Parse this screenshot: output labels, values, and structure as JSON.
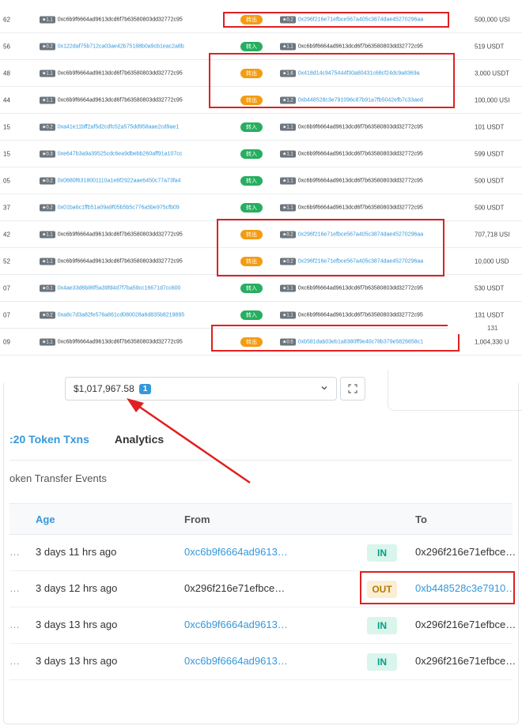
{
  "top_table": {
    "rows": [
      {
        "block": "62",
        "from_score": "★1.1",
        "from": "0xc6b9f6664ad9613dcd6f7b63580803dd32772c95",
        "from_link": false,
        "dir": "转出",
        "dir_type": "out",
        "to_score": "★0.2",
        "to": "0x296f216e71efbce567a405c3874dae45270296aa",
        "to_link": true,
        "amount": "500,000 USI"
      },
      {
        "block": "56",
        "from_score": "★0.2",
        "from": "0x122daf75b712ca03ae42b75188b0a9cb1eac2a8b",
        "from_link": true,
        "dir": "转入",
        "dir_type": "in",
        "to_score": "★1.1",
        "to": "0xc6b9f6664ad9613dcd6f7b63580803dd32772c95",
        "to_link": false,
        "amount": "519 USDT"
      },
      {
        "block": "48",
        "from_score": "★1.1",
        "from": "0xc6b9f6664ad9613dcd6f7b63580803dd32772c95",
        "from_link": false,
        "dir": "转出",
        "dir_type": "out",
        "to_score": "★1.6",
        "to": "0x418d14c9475444f30a80431c68cf24dc9a8369a",
        "to_link": true,
        "amount": "3,000 USDT"
      },
      {
        "block": "44",
        "from_score": "★1.1",
        "from": "0xc6b9f6664ad9613dcd6f7b63580803dd32772c95",
        "from_link": false,
        "dir": "转出",
        "dir_type": "out",
        "to_score": "★1.2",
        "to": "0xb448528c3e791096c87b91a7fb5042efb7c33aed",
        "to_link": true,
        "amount": "100,000 USI"
      },
      {
        "block": "15",
        "from_score": "★0.2",
        "from": "0xa41e11bff2af5d2cdfc52a575dd958aae2cd9ae1",
        "from_link": true,
        "dir": "转入",
        "dir_type": "in",
        "to_score": "★1.1",
        "to": "0xc6b9f6664ad9613dcd6f7b63580803dd32772c95",
        "to_link": false,
        "amount": "101 USDT"
      },
      {
        "block": "15",
        "from_score": "★0.3",
        "from": "0xe647b3a9a39525cdc6ea9dbebb260aff91a107cc",
        "from_link": true,
        "dir": "转入",
        "dir_type": "in",
        "to_score": "★1.1",
        "to": "0xc6b9f6664ad9613dcd6f7b63580803dd32772c95",
        "to_link": false,
        "amount": "599 USDT"
      },
      {
        "block": "05",
        "from_score": "★0.2",
        "from": "0x0680f6318001110a1e6f2922aae6450c77a73fa4",
        "from_link": true,
        "dir": "转入",
        "dir_type": "in",
        "to_score": "★1.1",
        "to": "0xc6b9f6664ad9613dcd6f7b63580803dd32772c95",
        "to_link": false,
        "amount": "500 USDT"
      },
      {
        "block": "37",
        "from_score": "★0.2",
        "from": "0x01ba6c1ffb51a09a9f05b5b5c776a5be975cfb09",
        "from_link": true,
        "dir": "转入",
        "dir_type": "in",
        "to_score": "★1.1",
        "to": "0xc6b9f6664ad9613dcd6f7b63580803dd32772c95",
        "to_link": false,
        "amount": "500 USDT"
      },
      {
        "block": "42",
        "from_score": "★1.1",
        "from": "0xc6b9f6664ad9613dcd6f7b63580803dd32772c95",
        "from_link": false,
        "dir": "转出",
        "dir_type": "out",
        "to_score": "★0.2",
        "to": "0x296f216e71efbce567a405c3874dae45270296aa",
        "to_link": true,
        "amount": "707,718 USI"
      },
      {
        "block": "52",
        "from_score": "★1.1",
        "from": "0xc6b9f6664ad9613dcd6f7b63580803dd32772c95",
        "from_link": false,
        "dir": "转出",
        "dir_type": "out",
        "to_score": "★0.2",
        "to": "0x296f216e71efbce567a405c3874dae45270296aa",
        "to_link": true,
        "amount": "10,000 USD"
      },
      {
        "block": "07",
        "from_score": "★0.1",
        "from": "0x4ae33d6b86f5a39fd4d7f7ba59cc16671d7cc600",
        "from_link": true,
        "dir": "转入",
        "dir_type": "in",
        "to_score": "★1.1",
        "to": "0xc6b9f6664ad9613dcd6f7b63580803dd32772c95",
        "to_link": false,
        "amount": "530 USDT"
      },
      {
        "block": "07",
        "from_score": "★0.2",
        "from": "0xa8c7d3a82fe576a861cd080028a6d835b8219895",
        "from_link": true,
        "dir": "转入",
        "dir_type": "in",
        "to_score": "★1.1",
        "to": "0xc6b9f6664ad9613dcd6f7b63580803dd32772c95",
        "to_link": false,
        "amount": "131 USDT"
      },
      {
        "block": "09",
        "from_score": "★1.1",
        "from": "0xc6b9f6664ad9613dcd6f7b63580803dd32772c95",
        "from_link": false,
        "dir": "转出",
        "dir_type": "out",
        "to_score": "★0.5",
        "to": "0xb581dab03eb1a8380ff9e40c78b379e5826658c1",
        "to_link": true,
        "amount": "1,004,330 U"
      }
    ],
    "overlap_text": "131"
  },
  "value_panel": {
    "value": "$1,017,967.58",
    "badge": "1"
  },
  "lower": {
    "tabs": [
      ":20 Token Txns",
      "Analytics"
    ],
    "subtitle": "oken Transfer Events",
    "headers": {
      "age": "Age",
      "from": "From",
      "to": "To"
    },
    "rows": [
      {
        "dots": "…",
        "age": "3 days 11 hrs ago",
        "from": "0xc6b9f6664ad9613…",
        "from_link": true,
        "dir": "IN",
        "dir_type": "in",
        "to": "0x296f216e71efbce…",
        "to_link": false
      },
      {
        "dots": "…",
        "age": "3 days 12 hrs ago",
        "from": "0x296f216e71efbce…",
        "from_link": false,
        "dir": "OUT",
        "dir_type": "out",
        "to": "0xb448528c3e7910…",
        "to_link": true
      },
      {
        "dots": "…",
        "age": "3 days 13 hrs ago",
        "from": "0xc6b9f6664ad9613…",
        "from_link": true,
        "dir": "IN",
        "dir_type": "in",
        "to": "0x296f216e71efbce…",
        "to_link": false
      },
      {
        "dots": "…",
        "age": "3 days 13 hrs ago",
        "from": "0xc6b9f6664ad9613…",
        "from_link": true,
        "dir": "IN",
        "dir_type": "in",
        "to": "0x296f216e71efbce…",
        "to_link": false
      }
    ]
  },
  "colors": {
    "highlight_red": "#e02020",
    "link_blue": "#3498db",
    "out_orange": "#f39c12",
    "in_green": "#27ae60"
  },
  "icons": {
    "dropdown": "chevron-down-icon",
    "expand": "expand-icon",
    "annotation": "arrow-annotation"
  }
}
